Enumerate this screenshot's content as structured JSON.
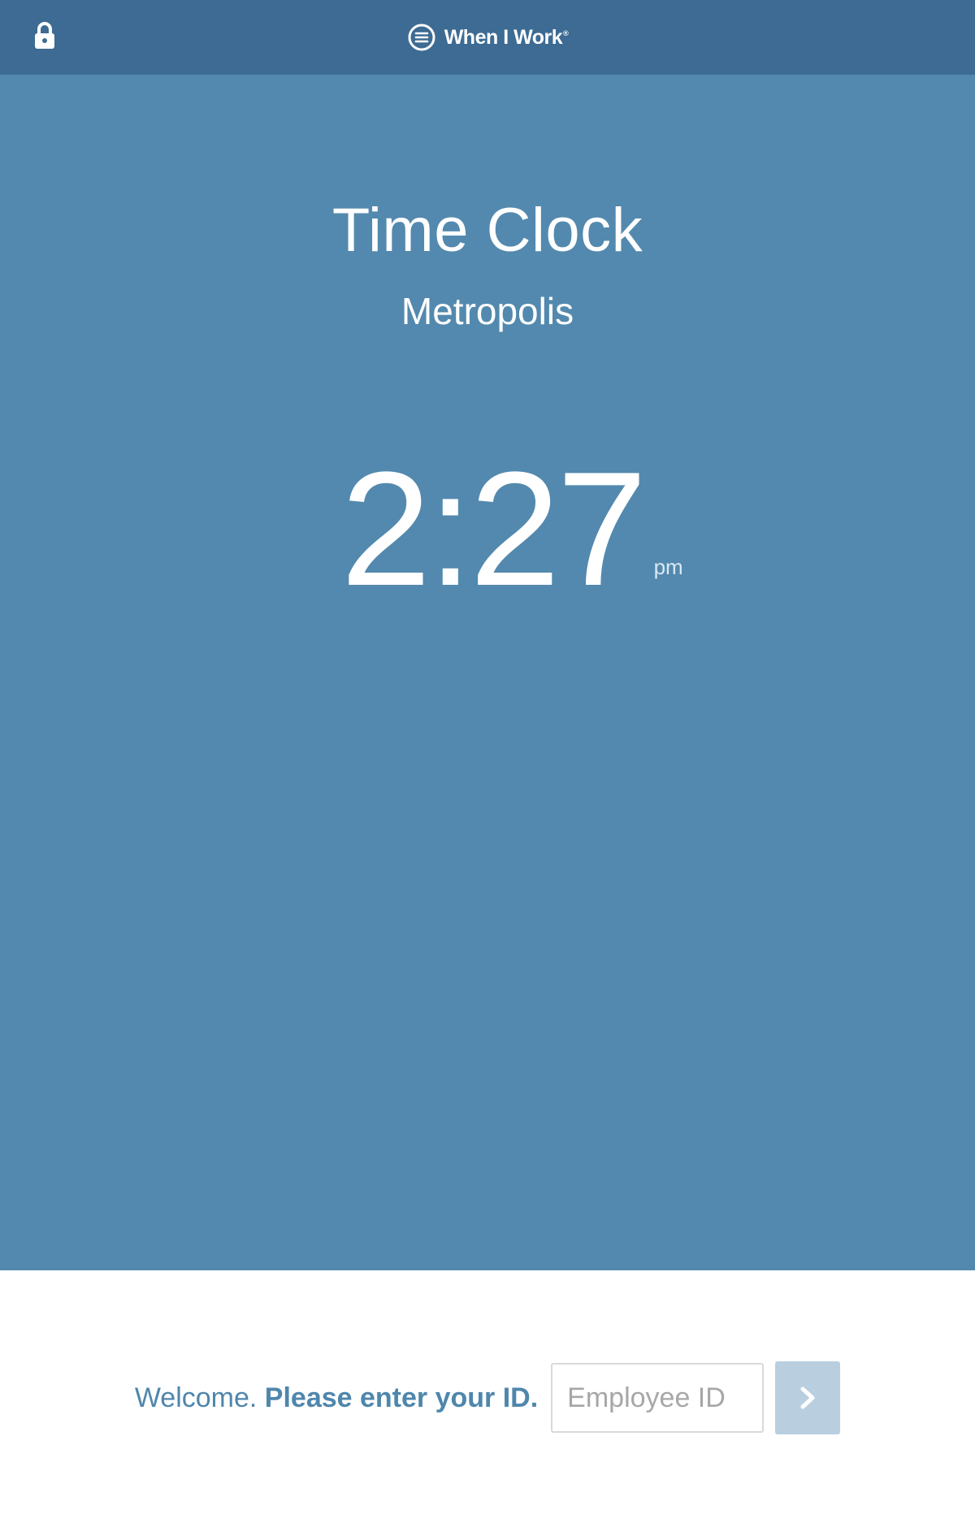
{
  "header": {
    "brand_name": "When I Work",
    "brand_mark": "®",
    "lock_icon": "lock-icon",
    "background": "#3d6b93"
  },
  "main": {
    "title": "Time Clock",
    "location": "Metropolis",
    "time": "2:27",
    "ampm": "pm",
    "background": "#5389ae"
  },
  "footer": {
    "welcome": "Welcome.",
    "prompt": "Please enter your ID.",
    "employee_id_placeholder": "Employee ID",
    "employee_id_value": "",
    "submit_icon": "chevron-right-icon",
    "accent": "#4f86ac",
    "button_color": "#b9cfe0"
  }
}
